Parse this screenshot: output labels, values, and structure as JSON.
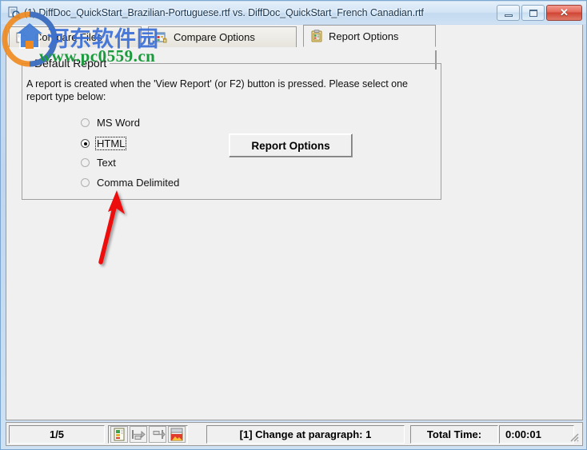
{
  "window": {
    "title": "(1) DiffDoc_QuickStart_Brazilian-Portuguese.rtf vs. DiffDoc_QuickStart_French Canadian.rtf",
    "app_icon": "diffdoc-icon",
    "controls": {
      "minimize": "minimize-icon",
      "maximize": "maximize-icon",
      "close_label": "✕"
    }
  },
  "tabs": [
    {
      "label": "Compare Files",
      "icon": "compare-files-icon",
      "active": false
    },
    {
      "label": "Compare Options",
      "icon": "compare-options-icon",
      "active": false
    },
    {
      "label": "Report Options",
      "icon": "report-options-icon",
      "active": true
    }
  ],
  "group": {
    "legend": "Default Report",
    "description": "A report is created when the 'View Report'  (or F2) button is pressed.  Please select one report type below:",
    "options": [
      {
        "label": "MS Word",
        "selected": false,
        "focused": false
      },
      {
        "label": "HTML",
        "selected": true,
        "focused": true
      },
      {
        "label": "Text",
        "selected": false,
        "focused": false
      },
      {
        "label": "Comma Delimited",
        "selected": false,
        "focused": false
      }
    ],
    "report_options_button": "Report Options"
  },
  "statusbar": {
    "page_counter": "1/5",
    "icon_buttons": [
      "report-view-icon",
      "prev-change-icon",
      "next-change-icon",
      "save-report-icon"
    ],
    "change_info": "[1] Change at paragraph: 1",
    "total_time_label": "Total Time:",
    "total_time_value": "0:00:01",
    "grip": "resize-grip-icon"
  },
  "watermark": {
    "logo": "site-logo-icon",
    "site_name": "河东软件园",
    "site_url": "www.pc0559.cn"
  },
  "annotation": {
    "arrow": "red-arrow-annotation",
    "color": "#ee1111"
  },
  "colors": {
    "titlebar": "#cfe1f3",
    "client_bg": "#f0f0f0",
    "close_button": "#cf4433",
    "accent_border": "#9a9a9a"
  }
}
